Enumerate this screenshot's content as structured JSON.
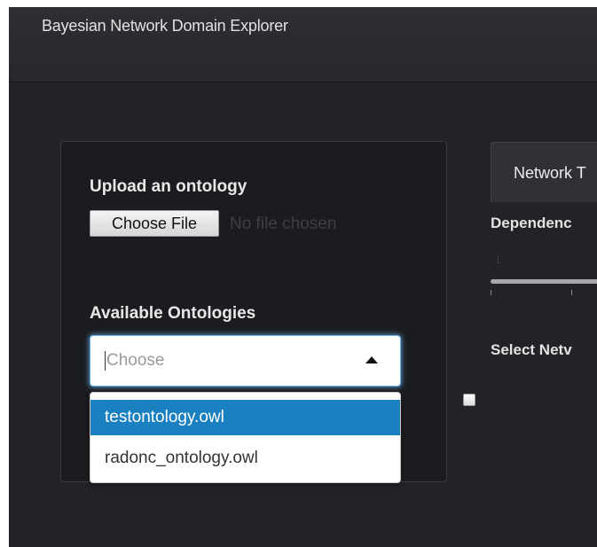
{
  "navbar": {
    "brand": "Bayesian Network Domain Explorer"
  },
  "sidebar": {
    "upload_label": "Upload an ontology",
    "file_button_label": "Choose File",
    "file_status": "No file chosen",
    "ontologies_label": "Available Ontologies",
    "select": {
      "placeholder": "Choose",
      "options": [
        "testontology.owl",
        "radonc_ontology.owl"
      ],
      "highlighted_index": 0
    }
  },
  "main": {
    "tab_label": "Network T",
    "dependency_label": "Dependenc",
    "slider": {
      "min_label": "1"
    },
    "select_network_label": "Select Netv"
  },
  "colors": {
    "background": "#222326",
    "focus_ring": "#66afe9",
    "option_highlight": "#1a80c0"
  }
}
